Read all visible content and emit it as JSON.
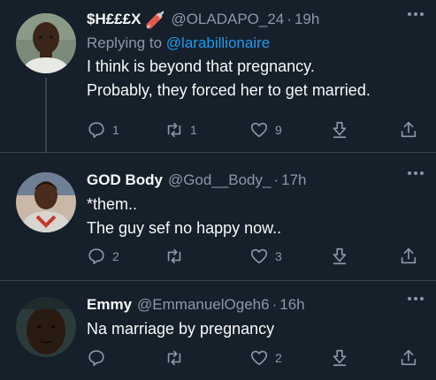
{
  "tweets": [
    {
      "display_name": "$H£££X",
      "emoji": "syringe-emoji",
      "handle": "@OLADAPO_24",
      "separator": "·",
      "time": "19h",
      "replying_prefix": "Replying to",
      "replying_to": "@larabillionaire",
      "lines": [
        "I think is beyond that pregnancy.",
        "Probably, they forced her to get married."
      ],
      "replies": "1",
      "retweets": "1",
      "likes": "9"
    },
    {
      "display_name": "GOD Body",
      "handle": "@God__Body_",
      "separator": "·",
      "time": "17h",
      "lines": [
        "*them..",
        "The guy sef no happy now.."
      ],
      "replies": "2",
      "retweets": "",
      "likes": "3"
    },
    {
      "display_name": "Emmy",
      "handle": "@EmmanuelOgeh6",
      "separator": "·",
      "time": "16h",
      "lines": [
        "Na marriage by pregnancy"
      ],
      "replies": "",
      "retweets": "",
      "likes": "2"
    }
  ],
  "colors": {
    "background": "#15202b",
    "text": "#f7f9f9",
    "muted": "#8b98a5",
    "link": "#1d9bf0",
    "divider": "#38444d"
  }
}
